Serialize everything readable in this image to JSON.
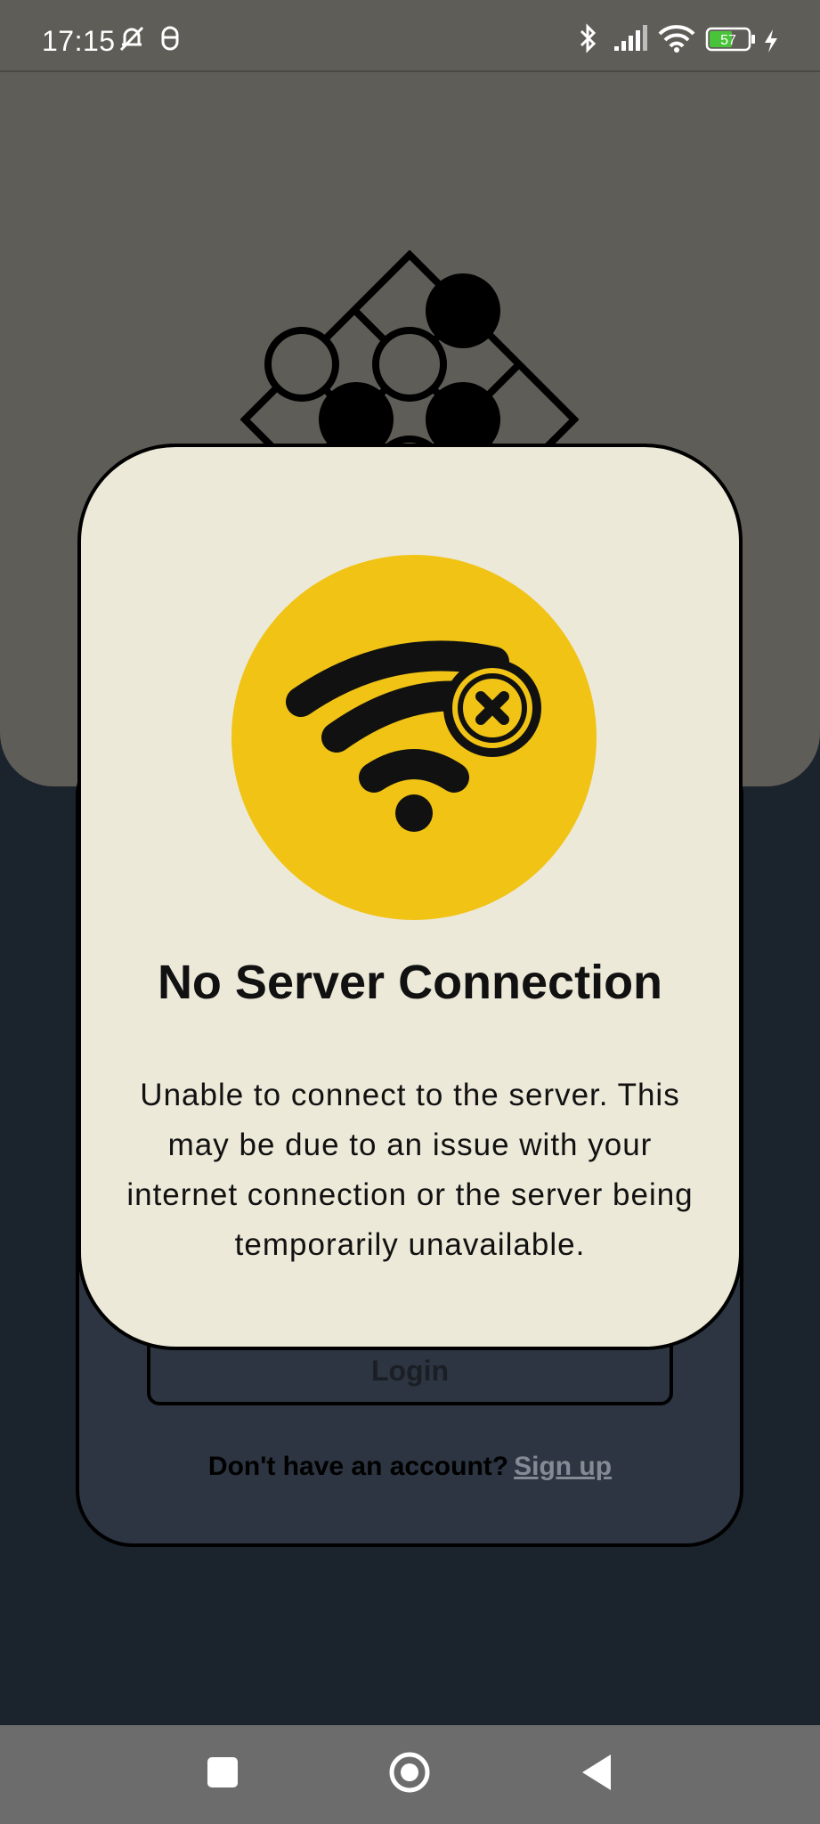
{
  "status_bar": {
    "time": "17:15",
    "battery_level": "57",
    "icons": [
      "muted-bell-icon",
      "mouse-icon",
      "bluetooth-icon",
      "signal-icon",
      "wifi-icon",
      "battery-icon",
      "charging-icon"
    ]
  },
  "header": {
    "logo": "go-board-logo-icon"
  },
  "login": {
    "button_label": "Login",
    "signup_prompt": "Don't have an account?",
    "signup_link": "Sign up"
  },
  "dialog": {
    "icon": "wifi-off-icon",
    "title": "No Server Connection",
    "message": "Unable to connect to the server. This may be due to an issue with your internet connection or the server being temporarily unavailable."
  },
  "nav_bar": {
    "buttons": [
      "recents-button",
      "home-button",
      "back-button"
    ]
  },
  "colors": {
    "header_bg": "#5f5d57",
    "page_bg": "#1b232d",
    "card_bg": "#2c3541",
    "dialog_bg": "#ede9d9",
    "accent": "#f0c315"
  }
}
